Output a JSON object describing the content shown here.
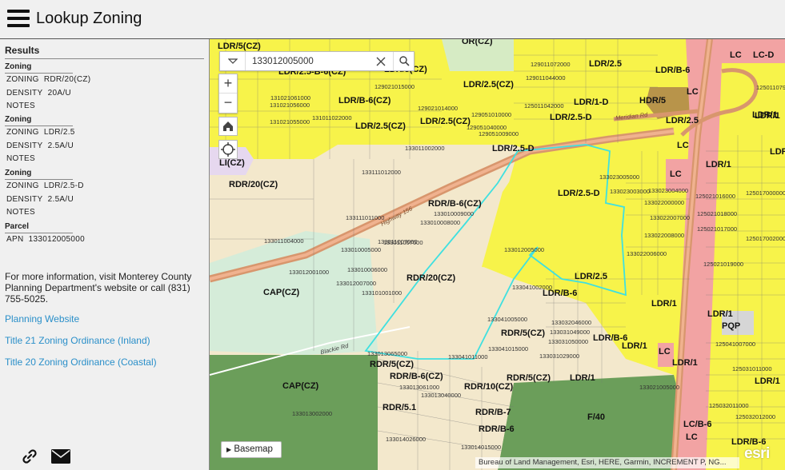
{
  "header": {
    "title": "Lookup Zoning"
  },
  "sidebar": {
    "results_title": "Results",
    "zoning_blocks": [
      {
        "title": "Zoning",
        "zoning_key": "ZONING",
        "zoning_val": "RDR/20(CZ)",
        "density_key": "DENSITY",
        "density_val": "20A/U",
        "notes_key": "NOTES"
      },
      {
        "title": "Zoning",
        "zoning_key": "ZONING",
        "zoning_val": "LDR/2.5",
        "density_key": "DENSITY",
        "density_val": "2.5A/U",
        "notes_key": "NOTES"
      },
      {
        "title": "Zoning",
        "zoning_key": "ZONING",
        "zoning_val": "LDR/2.5-D",
        "density_key": "DENSITY",
        "density_val": "2.5A/U",
        "notes_key": "NOTES"
      }
    ],
    "parcel": {
      "title": "Parcel",
      "apn_key": "APN",
      "apn_val": "133012005000"
    },
    "info_text": "For more information, visit Monterey County Planning Department's website or call (831) 755-5025.",
    "links": [
      "Planning Website",
      "Title 21 Zoning Ordinance (Inland)",
      "Title 20 Zoning Ordinance (Coastal)"
    ],
    "footer_icons": [
      "link-icon",
      "mail-icon"
    ]
  },
  "map": {
    "search": {
      "value": "133012005000",
      "placeholder": ""
    },
    "basemap_label": "Basemap",
    "attribution": "Bureau of Land Management, Esri, HERE, Garmin, INCREMENT P, NG...",
    "esri_logo": "esri",
    "colors": {
      "yellow": "#f7f34a",
      "tan": "#f3e8cc",
      "green": "#6b9e5a",
      "pink": "#f2a3a3",
      "cyan": "#3fe0e0",
      "teal_light": "#d5ecd9",
      "road": "#d8966d"
    },
    "zone_labels": [
      "LDR/5(CZ)",
      "OR(CZ)",
      "LDR/2.5",
      "LDR/2.5-B-6(CZ)",
      "LDR/5(CZ)",
      "LDR/B-6",
      "LC",
      "LC-D",
      "LDR/2.5(CZ)",
      "LDR/B-6(CZ)",
      "LDR/1-D",
      "HDR/5",
      "LC",
      "LDR/2.5(CZ)",
      "LDR/2.5(CZ)",
      "LDR/2.5-D",
      "LDR/2.5",
      "LDR/1",
      "LDR/2.5-D",
      "LC",
      "LI(CZ)",
      "LC",
      "LDR/1",
      "RDR/20(CZ)",
      "LDR/2.5-D",
      "LDR/1",
      "RDR/B-6(CZ)",
      "RDR/20(CZ)",
      "LDR/2.5",
      "CAP(CZ)",
      "LDR/B-6",
      "LDR/1",
      "LDR/1",
      "PQP",
      "RDR/5(CZ)",
      "LDR/B-6",
      "LDR/1",
      "LC",
      "LDR/1",
      "RDR/5(CZ)",
      "RDR/B-6(CZ)",
      "RDR/5(CZ)",
      "CAP(CZ)",
      "RDR/10(CZ)",
      "LDR/1",
      "RDR/5.1",
      "RDR/B-7",
      "F/40",
      "RDR/B-6",
      "LC/B-6",
      "LC",
      "LDR/B-6",
      "LDR/1",
      "LDR/1"
    ],
    "parcel_labels": [
      "133012005000",
      "133011002000",
      "133111012000",
      "133111011000",
      "133011004000",
      "133010005000",
      "133010006000",
      "133012007000",
      "133101001000",
      "133012001000",
      "133011007000",
      "133010009000",
      "133010008000",
      "133013065000",
      "133013061000",
      "133013040000",
      "133013002000",
      "133014026000",
      "133014015000",
      "133041011000",
      "133041002000",
      "133041015000",
      "133041005000",
      "133023003000",
      "133023005000",
      "133023004000",
      "133022006000",
      "133022008000",
      "133022007000",
      "133022000000",
      "125021016000",
      "125021018000",
      "125021017000",
      "125021019000",
      "125017000000",
      "125017002000",
      "125011079000",
      "125011042000",
      "129011072000",
      "129021015000",
      "129021014000",
      "129051010000",
      "129051009000",
      "131021061000",
      "131021056000",
      "131021055000",
      "131011022000",
      "129011044000",
      "129051040000",
      "133011007000",
      "125041007000",
      "125032011000",
      "125031011000",
      "125032012000",
      "133021005000",
      "133031049000",
      "133031050000",
      "133032046000",
      "133031029000"
    ],
    "road_label": "Highway 156",
    "road_label_2": "Meridian Rd",
    "road_label_3": "Blackie Rd"
  }
}
